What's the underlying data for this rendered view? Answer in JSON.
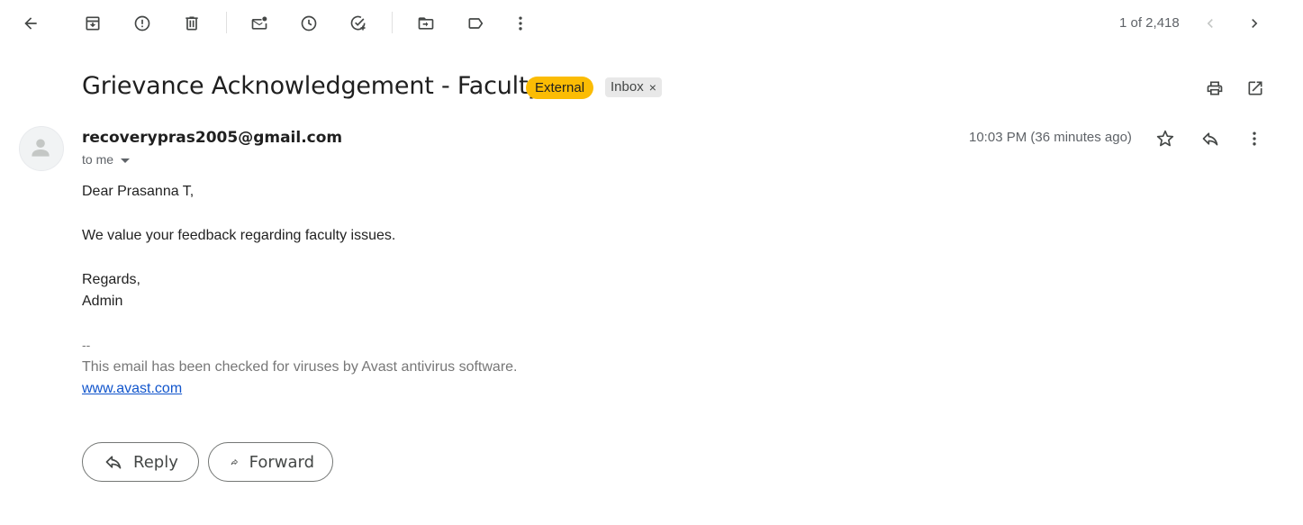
{
  "toolbar": {
    "icons": [
      "back-arrow-icon",
      "archive-icon",
      "report-spam-icon",
      "delete-icon",
      "mark-unread-icon",
      "snooze-icon",
      "add-to-tasks-icon",
      "move-to-icon",
      "labels-icon",
      "more-vert-icon"
    ],
    "pager_text": "1 of 2,418"
  },
  "email": {
    "subject": "Grievance Acknowledgement - Faculty",
    "chip_external": "External",
    "chip_inbox": "Inbox",
    "chip_inbox_close": "×",
    "sender": "recoverypras2005@gmail.com",
    "to": "to me",
    "time": "10:03 PM (36 minutes ago)",
    "greeting": "Dear Prasanna T,",
    "line1": "We value your feedback regarding faculty issues.",
    "regards": "Regards,",
    "signature": "Admin",
    "sig_sep": "--",
    "avast_note": "This email has been checked for viruses by Avast antivirus software.",
    "avast_link": "www.avast.com"
  },
  "actions": {
    "reply": "Reply",
    "forward": "Forward"
  },
  "colors": {
    "external_chip": "#fbbc04",
    "inbox_chip": "#e8e8e8",
    "link": "#1155cc"
  }
}
